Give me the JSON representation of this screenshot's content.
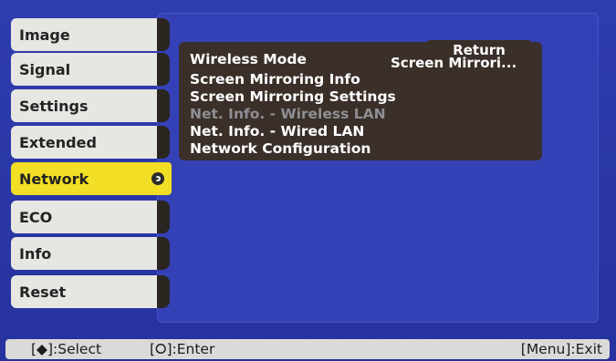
{
  "tabs": [
    {
      "label": "Image"
    },
    {
      "label": "Signal"
    },
    {
      "label": "Settings"
    },
    {
      "label": "Extended"
    },
    {
      "label": "Network"
    },
    {
      "label": "ECO"
    },
    {
      "label": "Info"
    },
    {
      "label": "Reset"
    }
  ],
  "selected_tab": "Network",
  "network_menu": {
    "return_label": "Return",
    "items": [
      {
        "label": "Wireless Mode",
        "value": "Screen Mirrori..."
      },
      {
        "label": "Screen Mirroring Info"
      },
      {
        "label": "Screen Mirroring Settings"
      },
      {
        "label": "Net. Info. - Wireless LAN",
        "disabled": true
      },
      {
        "label": "Net. Info. - Wired LAN"
      },
      {
        "label": "Network Configuration"
      }
    ]
  },
  "status_bar": {
    "select": "[◆]:Select",
    "enter": "[⭘]:Enter",
    "exit": "[Menu]:Exit"
  },
  "colors": {
    "background": "#2a37a6",
    "selected_tab": "#f2de24",
    "submenu": "#3a2f29",
    "disabled_text": "#8e8f94"
  },
  "icons": {
    "enter": "enter-icon",
    "select": "diamond-arrows-icon"
  }
}
